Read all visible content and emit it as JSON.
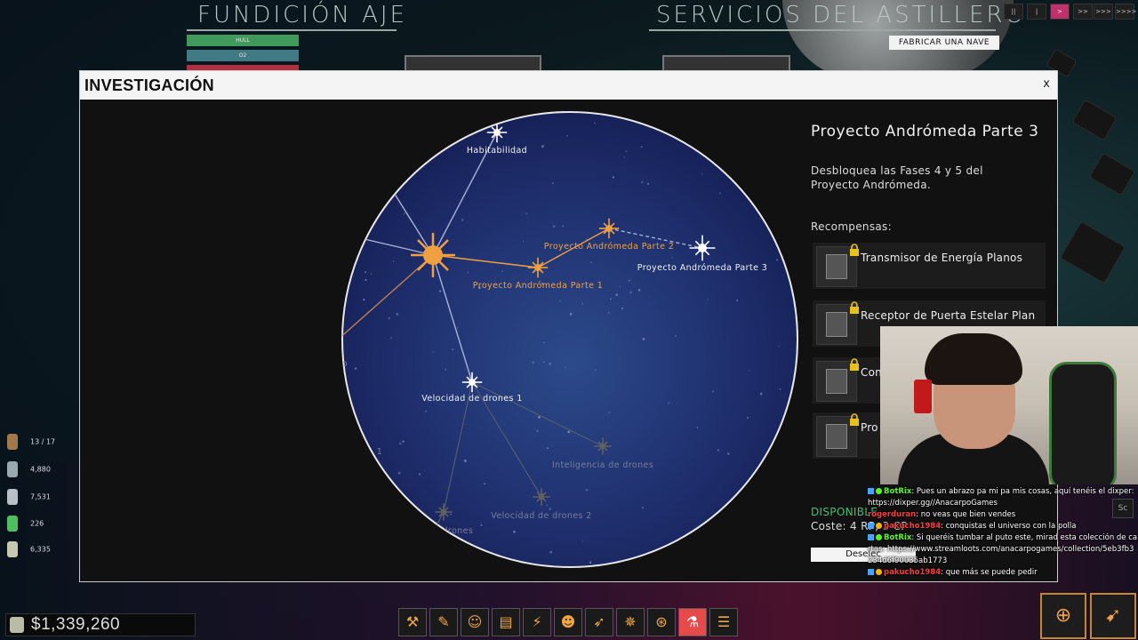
{
  "top_left": {
    "title": "FUNDICIÓN AJE",
    "bars": [
      "HULL",
      "O2",
      ""
    ]
  },
  "top_right": {
    "title": "SERVICIOS DEL ASTILLERO",
    "build_button": "FABRICAR UNA NAVE"
  },
  "speed_controls": {
    "buttons": [
      "||",
      "|",
      ">",
      ">>",
      ">>>",
      ">>>>"
    ],
    "active_index": 2
  },
  "dialog": {
    "title": "INVESTIGACIÓN",
    "close": "x"
  },
  "tree": {
    "nodes": [
      {
        "label": "Habitabilidad",
        "state": "unlocked"
      },
      {
        "label": "Proyecto Andrómeda Parte 2",
        "state": "researched"
      },
      {
        "label": "Proyecto Andrómeda Parte 3",
        "state": "selected"
      },
      {
        "label": "Proyecto Andrómeda Parte 1",
        "state": "researched"
      },
      {
        "label": "Velocidad de drones 1",
        "state": "unlocked"
      },
      {
        "label": "Inteligencia de drones",
        "state": "locked"
      },
      {
        "label": "Velocidad de drones 2",
        "state": "locked"
      },
      {
        "label": "e drones",
        "state": "locked"
      },
      {
        "label": "1",
        "state": "locked"
      },
      {
        "label": "o",
        "state": "locked"
      }
    ]
  },
  "details": {
    "title": "Proyecto Andrómeda Parte 3",
    "description": "Desbloquea las Fases 4 y 5 del Proyecto Andrómeda.",
    "rewards_label": "Recompensas:",
    "rewards": [
      {
        "label": "Transmisor de Energía Planos"
      },
      {
        "label": "Receptor de Puerta Estelar Plan"
      },
      {
        "label": "Con"
      },
      {
        "label": "Pro 5"
      }
    ],
    "status": "DISPONIBLE",
    "cost": "Coste: 4 RP, 3 CP",
    "deselect_button": "Deselec"
  },
  "chat": [
    {
      "name": "BotRix",
      "name_color": "#53fc18",
      "text": ": Pues un abrazo pa mi pa mis cosas, aquí tenéis el dixper: https://dixper.gg//AnacarpoGames"
    },
    {
      "name": "rogerduran",
      "name_color": "#ff3b3b",
      "text": ": no veas que bien vendes"
    },
    {
      "name": "pakucho1984",
      "name_color": "#ff3b3b",
      "text": ": conquistas el universo con la polla"
    },
    {
      "name": "BotRix",
      "name_color": "#53fc18",
      "text": ": Si queréis tumbar al puto este, mirad esta colección de cartas: https://www.streamloots.com/anacarpogames/collection/5eb3fb3234d6f90035ab1773"
    },
    {
      "name": "pakucho1984",
      "name_color": "#ff3b3b",
      "text": ": que más se puede pedir"
    }
  ],
  "chat_side_label": "Sc",
  "resources": [
    {
      "icon": "crew-icon",
      "value": "13 / 17"
    },
    {
      "icon": "energy-cell-icon",
      "value": "4,880"
    },
    {
      "icon": "battery-icon",
      "value": "7,531"
    },
    {
      "icon": "green-canister-icon",
      "value": "226"
    },
    {
      "icon": "fuel-canister-icon",
      "value": "6,335"
    }
  ],
  "money": "$1,339,260",
  "toolbar": [
    {
      "name": "build-tools-icon",
      "glyph": "⚒"
    },
    {
      "name": "edit-icon",
      "glyph": "✎"
    },
    {
      "name": "crew-management-icon",
      "glyph": "☺"
    },
    {
      "name": "documents-icon",
      "glyph": "▤"
    },
    {
      "name": "power-icon",
      "glyph": "⚡"
    },
    {
      "name": "alien-icon",
      "glyph": "☻"
    },
    {
      "name": "rocket-icon",
      "glyph": "➶"
    },
    {
      "name": "compass-icon",
      "glyph": "✵"
    },
    {
      "name": "station-icon",
      "glyph": "⊛"
    },
    {
      "name": "research-flask-icon",
      "glyph": "⚗",
      "active": true
    },
    {
      "name": "list-menu-icon",
      "glyph": "☰"
    }
  ],
  "corner_buttons": [
    {
      "name": "target-icon",
      "glyph": "⊕"
    },
    {
      "name": "ship-select-icon",
      "glyph": "➹"
    }
  ],
  "colors": {
    "researched": "#f0a040",
    "unlocked": "#ffffff",
    "locked": "#606060",
    "available": "#3fbf7a",
    "active_tab": "#c0306a"
  }
}
